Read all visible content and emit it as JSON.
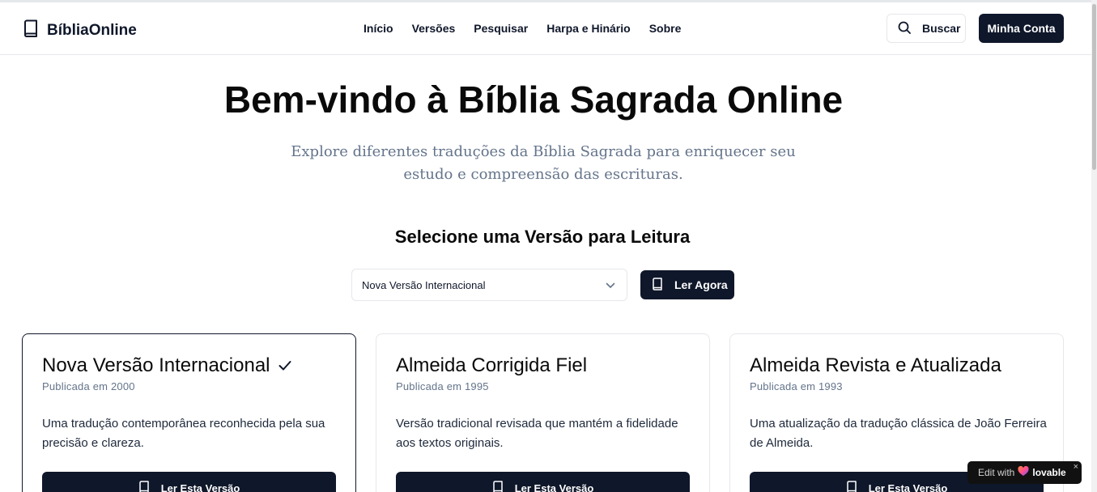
{
  "header": {
    "brand": "BíbliaOnline",
    "nav": [
      "Início",
      "Versões",
      "Pesquisar",
      "Harpa e Hinário",
      "Sobre"
    ],
    "search_label": "Buscar",
    "account_label": "Minha Conta"
  },
  "hero": {
    "title": "Bem-vindo à Bíblia Sagrada Online",
    "subtitle": "Explore diferentes traduções da Bíblia Sagrada para enriquecer seu estudo e compreensão das escrituras."
  },
  "selector": {
    "title": "Selecione uma Versão para Leitura",
    "selected_value": "Nova Versão Internacional",
    "read_now_label": "Ler Agora"
  },
  "cards": [
    {
      "title": "Nova Versão Internacional",
      "year": "Publicada em 2000",
      "description": "Uma tradução contemporânea reconhecida pela sua precisão e clareza.",
      "button": "Ler Esta Versão",
      "selected": true
    },
    {
      "title": "Almeida Corrigida Fiel",
      "year": "Publicada em 1995",
      "description": "Versão tradicional revisada que mantém a fidelidade aos textos originais.",
      "button": "Ler Esta Versão",
      "selected": false
    },
    {
      "title": "Almeida Revista e Atualizada",
      "year": "Publicada em 1993",
      "description": "Uma atualização da tradução clássica de João Ferreira de Almeida.",
      "button": "Ler Esta Versão",
      "selected": false
    }
  ],
  "badge": {
    "edit_with": "Edit with",
    "brand": "lovable",
    "close": "×"
  },
  "colors": {
    "primary": "#0f172a",
    "border": "#e5e7eb",
    "muted": "#64748b"
  },
  "icons": [
    "book-icon",
    "search-icon",
    "chevron-down-icon",
    "check-icon",
    "heart-icon",
    "close-icon"
  ]
}
